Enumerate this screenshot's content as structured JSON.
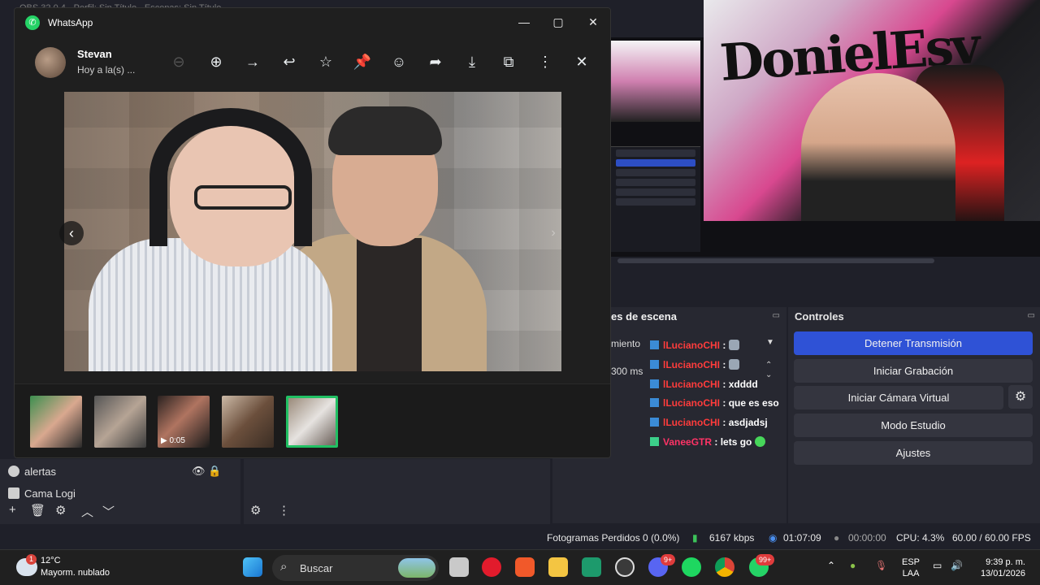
{
  "obs": {
    "title": "OBS 32.0.4 - Perfil: Sin Título - Escenas: Sin Título",
    "scene_transitions_title": "es de escena",
    "transition_label": "miento",
    "duration": "300 ms",
    "controls": {
      "title": "Controles",
      "stop_stream": "Detener Transmisión",
      "start_recording": "Iniciar Grabación",
      "start_virtual_cam": "Iniciar Cámara Virtual",
      "studio_mode": "Modo Estudio",
      "settings": "Ajustes"
    },
    "sources": [
      {
        "name": "alertas"
      },
      {
        "name": "Cama Logi"
      }
    ],
    "status": {
      "dropped_frames": "Fotogramas Perdidos 0 (0.0%)",
      "bitrate": "6167 kbps",
      "stream_time": "01:07:09",
      "rec_time": "00:00:00",
      "cpu": "CPU: 4.3%",
      "fps": "60.00 / 60.00 FPS"
    },
    "chat": [
      {
        "user": "lLucianoCHI",
        "msg": ":",
        "icon": "dish-emote"
      },
      {
        "user": "lLucianoCHI",
        "msg": ":",
        "icon": "dish-emote"
      },
      {
        "user": "lLucianoCHI",
        "msg": ": xdddd"
      },
      {
        "user": "lLucianoCHI",
        "msg": ": que es eso"
      },
      {
        "user": "lLucianoCHI",
        "msg": ": asdjadsj"
      },
      {
        "user": "VaneeGTR",
        "msg": ": lets go",
        "icon": "green-emote"
      }
    ]
  },
  "whatsapp": {
    "app_title": "WhatsApp",
    "contact_name": "Stevan",
    "contact_sub": "Hoy a la(s) ...",
    "video_duration": "0:05",
    "thumbnail_count": 5,
    "active_thumbnail": 5
  },
  "taskbar": {
    "temperature": "12°C",
    "forecast": "Mayorm. nublado",
    "weather_badge": "1",
    "search_label": "Buscar",
    "whatsapp_badge": "99+",
    "discord_badge": "9+",
    "lang_1": "ESP",
    "lang_2": "LAA",
    "time": "9:39 p. m.",
    "date": "13/01/2026"
  },
  "colors": {
    "obs_bg": "#1f2029",
    "accent_blue": "#2f52d6",
    "whatsapp_green": "#25d366",
    "chat_user_red": "#ff3c3c"
  }
}
